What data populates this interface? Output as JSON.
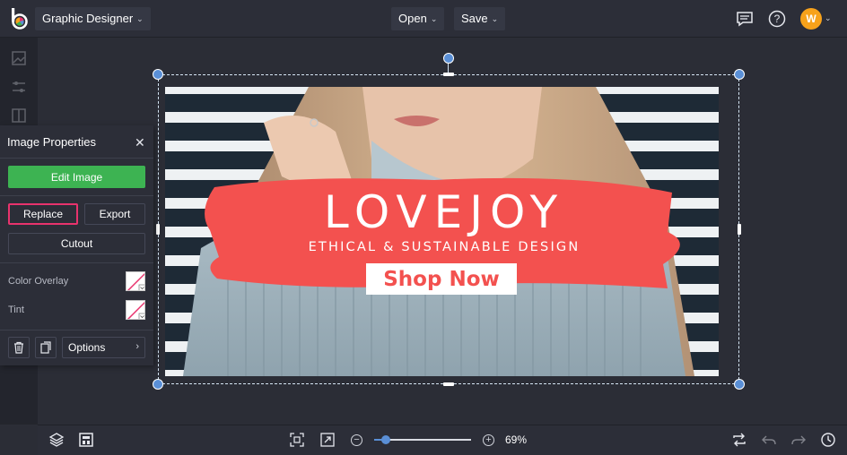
{
  "app": {
    "project_menu": "Graphic Designer",
    "open_label": "Open",
    "save_label": "Save",
    "avatar_initial": "W",
    "icons": [
      "logo-icon",
      "chat-icon",
      "help-icon"
    ]
  },
  "canvas": {
    "brand_text": "LOVEJOY",
    "tagline": "ETHICAL & SUSTAINABLE DESIGN",
    "cta": "Shop Now",
    "accent_color": "#f3514f"
  },
  "panel": {
    "title": "Image Properties",
    "edit_image": "Edit Image",
    "replace": "Replace",
    "export": "Export",
    "cutout": "Cutout",
    "color_overlay": "Color Overlay",
    "tint": "Tint",
    "options": "Options"
  },
  "bottombar": {
    "zoom_value": "69%",
    "zoom_fraction": 0.12
  },
  "colors": {
    "selection": "#5a8fd6",
    "highlight": "#e8336d",
    "primary_button": "#3db352"
  }
}
